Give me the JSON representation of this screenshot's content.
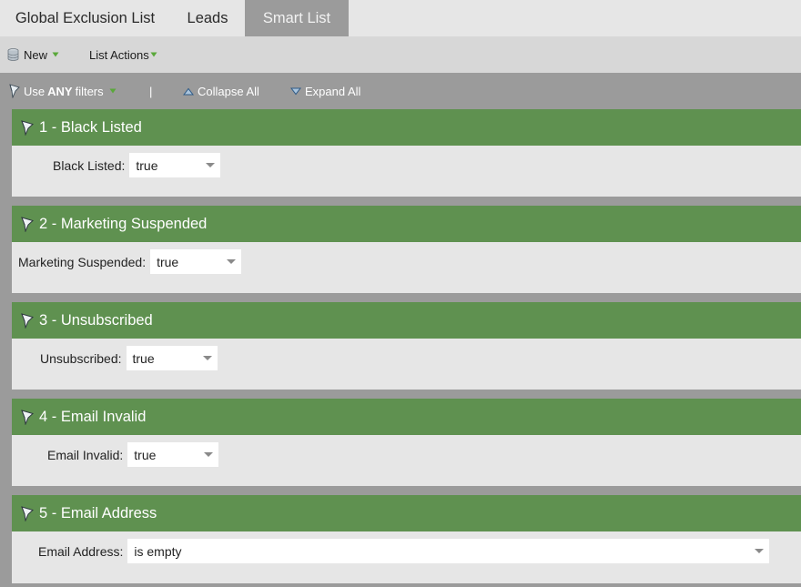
{
  "tabs": [
    {
      "label": "Global Exclusion List"
    },
    {
      "label": "Leads"
    },
    {
      "label": "Smart List"
    }
  ],
  "toolbar": {
    "new_label": "New",
    "list_actions_label": "List Actions"
  },
  "filterbar": {
    "use_prefix": "Use",
    "use_any": "ANY",
    "use_suffix": "filters",
    "separator": "|",
    "collapse_all": "Collapse All",
    "expand_all": "Expand All"
  },
  "filters": [
    {
      "title": "1 - Black Listed",
      "label": "Black Listed:",
      "value": "true"
    },
    {
      "title": "2 - Marketing Suspended",
      "label": "Marketing Suspended:",
      "value": "true"
    },
    {
      "title": "3 - Unsubscribed",
      "label": "Unsubscribed:",
      "value": "true"
    },
    {
      "title": "4 - Email Invalid",
      "label": "Email Invalid:",
      "value": "true"
    },
    {
      "title": "5 - Email Address",
      "label": "Email Address:",
      "value": "is empty"
    }
  ],
  "colors": {
    "header_green": "#5f9150",
    "body_gray": "#e6e6e6",
    "background_gray": "#9b9b9b",
    "toolbar_gray": "#d7d7d7"
  }
}
